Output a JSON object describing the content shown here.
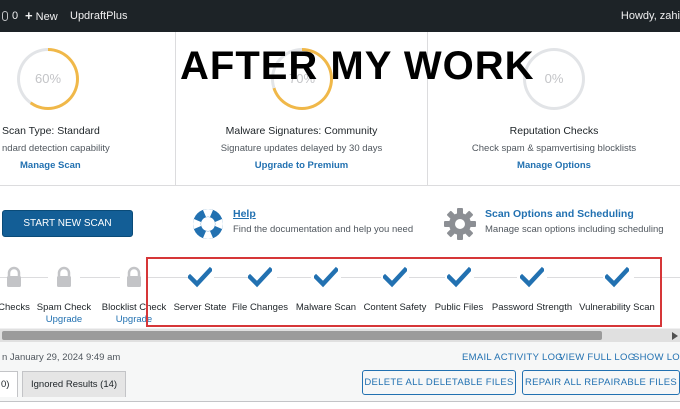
{
  "adminbar": {
    "comments_count": "0",
    "new_label": "New",
    "plugin_label": "UpdraftPlus",
    "howdy": "Howdy, zahi"
  },
  "overlay_text": "AFTER MY WORK",
  "cards": [
    {
      "percent": "60%",
      "progress": 0.6,
      "title": "Scan Type: Standard",
      "subtitle": "ndard detection capability",
      "link": "Manage Scan"
    },
    {
      "percent": "70%",
      "progress": 0.7,
      "title": "Malware Signatures: Community",
      "subtitle": "Signature updates delayed by 30 days",
      "link": "Upgrade to Premium"
    },
    {
      "percent": "0%",
      "progress": 0,
      "title": "Reputation Checks",
      "subtitle": "Check spam & spamvertising blocklists",
      "link": "Manage Options"
    }
  ],
  "actions": {
    "start_scan": "START NEW SCAN",
    "help_title": "Help",
    "help_desc": "Find the documentation and help you need",
    "options_title": "Scan Options and Scheduling",
    "options_desc": "Manage scan options including scheduling"
  },
  "steps": [
    {
      "label": "Checks",
      "status": "locked",
      "sub": ""
    },
    {
      "label": "Spam Check",
      "status": "locked",
      "sub": "Upgrade"
    },
    {
      "label": "Blocklist Check",
      "status": "locked",
      "sub": "Upgrade"
    },
    {
      "label": "Server State",
      "status": "done",
      "sub": ""
    },
    {
      "label": "File Changes",
      "status": "done",
      "sub": ""
    },
    {
      "label": "Malware Scan",
      "status": "done",
      "sub": ""
    },
    {
      "label": "Content Safety",
      "status": "done",
      "sub": ""
    },
    {
      "label": "Public Files",
      "status": "done",
      "sub": ""
    },
    {
      "label": "Password Strength",
      "status": "done",
      "sub": ""
    },
    {
      "label": "Vulnerability Scan",
      "status": "done",
      "sub": ""
    }
  ],
  "meta": {
    "date": "n January 29, 2024 9:49 am",
    "email_log": "EMAIL ACTIVITY LOG",
    "full_log": "VIEW FULL LOG",
    "show_log": "SHOW LOG"
  },
  "tabs": {
    "first_partial": "0)",
    "ignored": "Ignored Results (14)"
  },
  "buttons": {
    "delete_all": "DELETE ALL DELETABLE FILES",
    "repair_all": "REPAIR ALL REPAIRABLE FILES"
  },
  "colors": {
    "gauge_accent": "#f0b849",
    "gauge_track": "#e2e4e7",
    "link": "#2271b1",
    "check": "#2271b1",
    "primary_button": "#135e96",
    "highlight_border": "#d63638"
  }
}
